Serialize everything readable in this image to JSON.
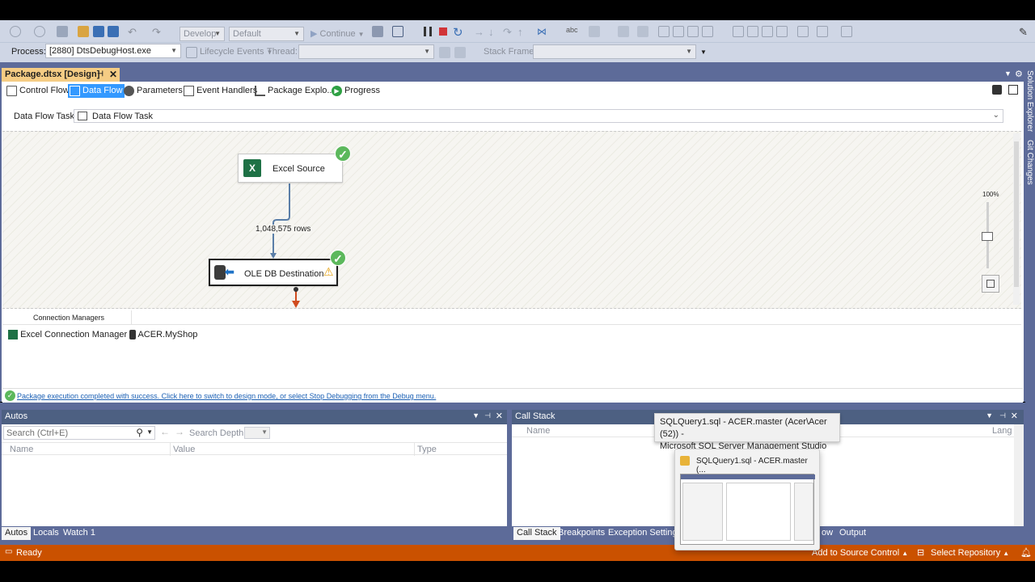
{
  "toolbar": {
    "config_value": "Develop",
    "platform_value": "Default",
    "continue_label": "Continue"
  },
  "debug_toolbar": {
    "process_label": "Process:",
    "process_value": "[2880] DtsDebugHost.exe",
    "lifecycle_label": "Lifecycle Events",
    "thread_label": "Thread:",
    "stack_frame_label": "Stack Frame:"
  },
  "document": {
    "tab_title": "Package.dtsx [Design]",
    "design_tabs": [
      "Control Flow",
      "Data Flow",
      "Parameters",
      "Event Handlers",
      "Package Explo...",
      "Progress"
    ],
    "task_label": "Data Flow Task:",
    "task_value": "Data Flow Task",
    "zoom": "100%"
  },
  "dataflow": {
    "source_name": "Excel Source",
    "path_label": "1,048,575 rows",
    "destination_name": "OLE DB Destination"
  },
  "connection_managers": {
    "header": "Connection Managers",
    "items": [
      "Excel Connection Manager",
      "ACER.MyShop"
    ]
  },
  "info_bar": {
    "message": "Package execution completed with success. Click here to switch to design mode, or select Stop Debugging from the Debug menu."
  },
  "autos_panel": {
    "title": "Autos",
    "search_placeholder": "Search (Ctrl+E)",
    "search_depth_label": "Search Depth:",
    "columns": [
      "Name",
      "Value",
      "Type"
    ],
    "tabs": [
      "Autos",
      "Locals",
      "Watch 1"
    ]
  },
  "callstack_panel": {
    "title": "Call Stack",
    "columns": [
      "Name",
      "Lang"
    ],
    "tabs": [
      "Call Stack",
      "Breakpoints",
      "Exception Settings",
      "ow",
      "Output"
    ]
  },
  "side_tabs": {
    "solution_explorer": "Solution Explorer",
    "git_changes": "Git Changes"
  },
  "status_bar": {
    "ready": "Ready",
    "source_control": "Add to Source Control",
    "repository": "Select Repository"
  },
  "taskbar_popup": {
    "tooltip_line1": "SQLQuery1.sql - ACER.master (Acer\\Acer (52)) -",
    "tooltip_line2": "Microsoft SQL Server Management Studio",
    "thumb_title": "SQLQuery1.sql - ACER.master (..."
  },
  "colors": {
    "chrome": "#cfd6e5",
    "well": "#5d6b99",
    "doc_tab": "#f5cc84",
    "active_tab": "#3399ff",
    "status": "#ca5100",
    "success": "#5cb85c"
  }
}
